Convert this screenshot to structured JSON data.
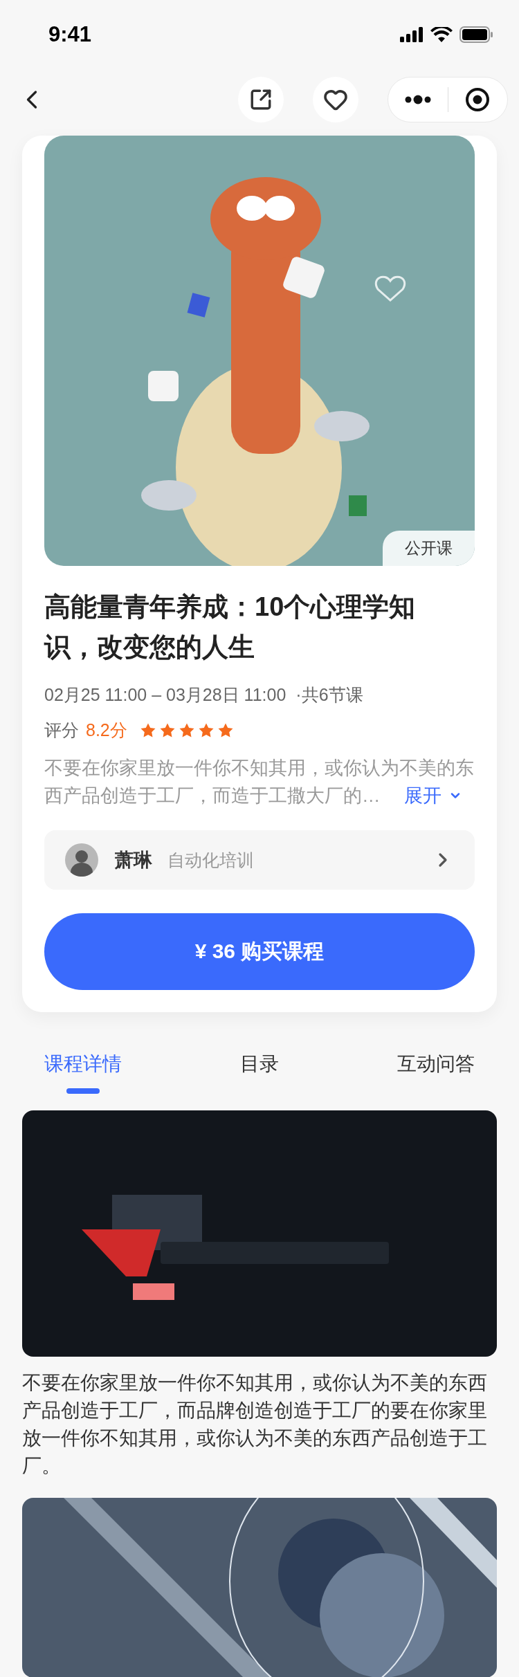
{
  "status_bar": {
    "time": "9:41"
  },
  "course": {
    "cover": {
      "kind": "picture",
      "badge": "公开课"
    },
    "title": "高能量青年养成：10个心理学知识，改变您的人生",
    "schedule": "02月25 11:00 – 03月28日 11:00",
    "lessons": "·共6节课",
    "rating_label": "评分",
    "rating": "8.2分",
    "stars": 5,
    "description": "不要在你家里放一件你不知其用，或你认为不美的东西产品创造于工厂，而造于工撒大厂的…",
    "expand": "展开",
    "teacher": {
      "name": "萧琳",
      "tag": "自动化培训"
    },
    "buy_button": "¥ 36 购买课程"
  },
  "tabs": [
    {
      "label": "课程详情",
      "selected": true
    },
    {
      "label": "目录",
      "selected": false
    },
    {
      "label": "互动问答",
      "selected": false
    }
  ],
  "detail": [
    {
      "kind": "picture"
    },
    {
      "kind": "paragraph",
      "text": "不要在你家里放一件你不知其用，或你认为不美的东西产品创造于工厂，而品牌创造创造于工厂的要在你家里放一件你不知其用，或你认为不美的东西产品创造于工厂。"
    },
    {
      "kind": "picture"
    }
  ]
}
